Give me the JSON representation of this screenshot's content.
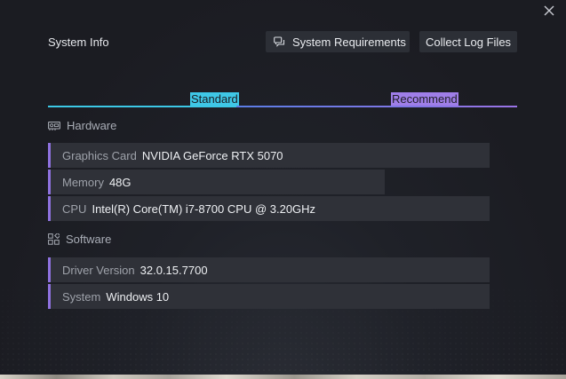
{
  "dialog": {
    "title": "System Info",
    "buttons": {
      "system_requirements": "System Requirements",
      "collect_logs": "Collect Log Files"
    },
    "tabs": [
      {
        "label": "Standard",
        "color": "#3fc7e6"
      },
      {
        "label": "Recommend",
        "color": "#9f7ee8"
      }
    ]
  },
  "hardware": {
    "heading": "Hardware",
    "icon": "gpu-card-icon",
    "rows": [
      {
        "label": "Graphics Card",
        "value": "NVIDIA GeForce RTX 5070"
      },
      {
        "label": "Memory",
        "value": "48G"
      },
      {
        "label": "CPU",
        "value": "Intel(R) Core(TM) i7-8700 CPU @ 3.20GHz"
      }
    ]
  },
  "software": {
    "heading": "Software",
    "icon": "apps-grid-icon",
    "rows": [
      {
        "label": "Driver Version",
        "value": "32.0.15.7700"
      },
      {
        "label": "System",
        "value": "Windows 10"
      }
    ]
  },
  "colors": {
    "accent_standard": "#3cc8e6",
    "accent_recommend": "#9f7ee8",
    "row_border": "#8f72e0",
    "background": "#1b1c22"
  }
}
